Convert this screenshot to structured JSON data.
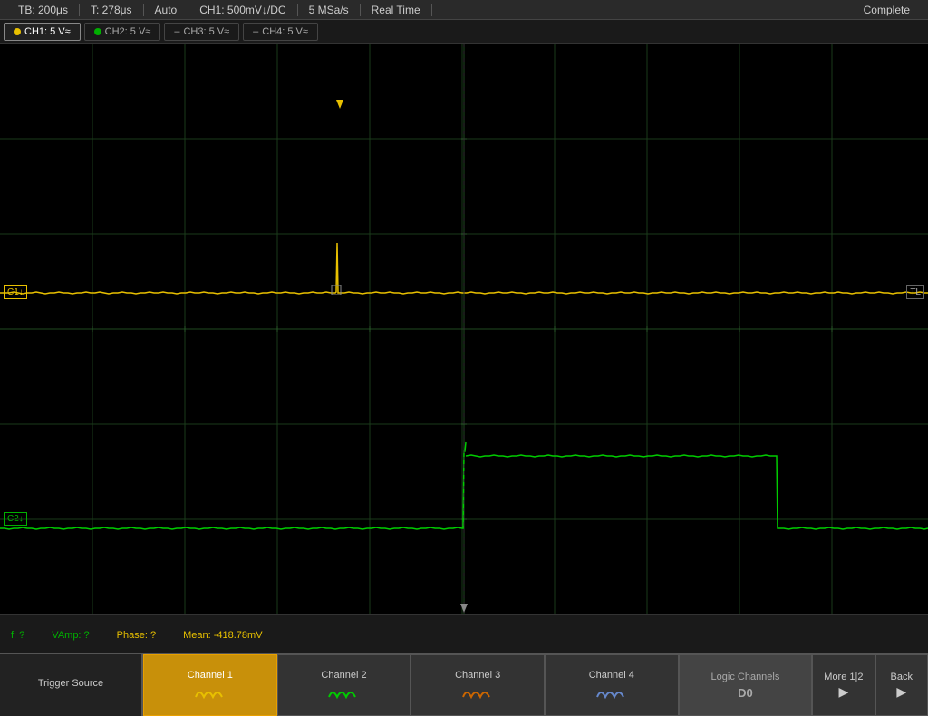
{
  "status_bar": {
    "tb": "TB: 200μs",
    "t": "T: 278μs",
    "mode": "Auto",
    "ch1_setting": "CH1: 500mV↓/DC",
    "sample_rate": "5 MSa/s",
    "time_mode": "Real Time",
    "status": "Complete"
  },
  "channel_tabs": [
    {
      "id": "CH1",
      "label": "CH1: 5 V≈",
      "active": true,
      "color": "yellow"
    },
    {
      "id": "CH2",
      "label": "CH2: 5 V≈",
      "active": false,
      "color": "green"
    },
    {
      "id": "CH3",
      "label": "CH3: 5 V≈",
      "active": false,
      "color": "gray"
    },
    {
      "id": "CH4",
      "label": "CH4: 5 V≈",
      "active": false,
      "color": "gray"
    }
  ],
  "measurements": {
    "freq": "f: ?",
    "vamp": "VAmp: ?",
    "phase": "Phase: ?",
    "mean": "Mean: -418.78mV"
  },
  "trigger_source_label": "Trigger Source",
  "buttons": [
    {
      "id": "ch1",
      "label": "Channel 1",
      "wave_color": "#e8c000",
      "active": true
    },
    {
      "id": "ch2",
      "label": "Channel 2",
      "wave_color": "#00cc00",
      "active": false
    },
    {
      "id": "ch3",
      "label": "Channel 3",
      "wave_color": "#cc6600",
      "active": false
    },
    {
      "id": "ch4",
      "label": "Channel 4",
      "wave_color": "#6688cc",
      "active": false
    },
    {
      "id": "logic",
      "label": "Logic Channels\nD0",
      "active": false
    },
    {
      "id": "more",
      "label": "More 1|2",
      "active": false
    },
    {
      "id": "back",
      "label": "Back",
      "active": false
    }
  ],
  "logic_channels_line1": "Logic Channels",
  "logic_channels_line2": "D0",
  "more_label": "More 1|2",
  "back_label": "Back",
  "ch1_scope_label": "C1↓",
  "ch2_scope_label": "C2↓",
  "tl_label": "TL",
  "trigger_t_label": "T",
  "colors": {
    "yellow": "#e8c000",
    "green": "#00b800",
    "grid": "#1a3a1a",
    "grid_line": "#0d2a0d",
    "bg": "#000000"
  }
}
